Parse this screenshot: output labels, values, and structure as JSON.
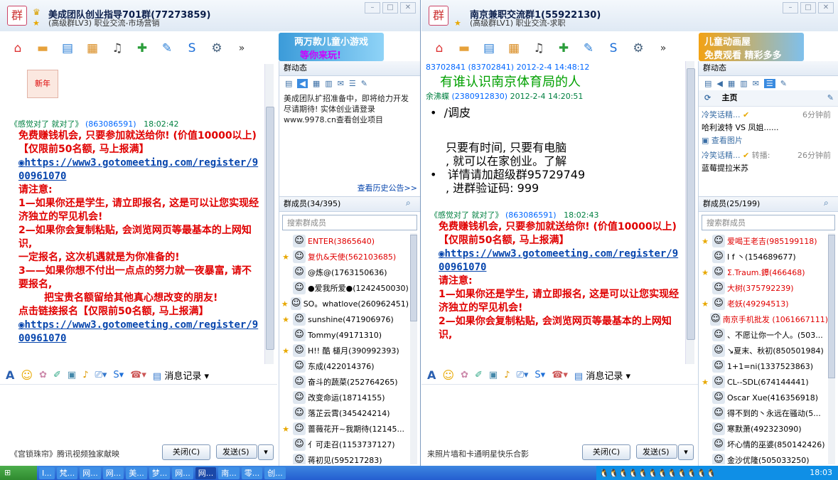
{
  "left_window": {
    "title": "美成团队创业指导701群(77273859)",
    "subtitle": "(高级群LV3) 职业交流-市场营销",
    "ad": {
      "line1": "两万款儿童小游戏",
      "line2": "等你来玩!"
    },
    "messages": [
      {
        "sender": "《感觉对了 就对了》",
        "id": "(863086591)",
        "time": "18:02:42"
      }
    ],
    "msg_lines": [
      "免费赚钱机会, 只要参加就送给你! (价值10000以上)",
      "【仅限前50名额, 马上报满】"
    ],
    "link1": "https://www3.gotomeeting.com/register/900961070",
    "msg_lines2": [
      "请注意:",
      "1—如果你还是学生, 请立即报名, 这是可以让您实现经济独立的罕见机会!",
      "2—如果你会复制粘贴, 会浏览网页等最基本的上网知识,",
      "一定报名, 这次机遇就是为你准备的!",
      "3——如果你想不付出一点点的努力就一夜暴富, 请不要报名,",
      "把宝贵名额留给其他真心想改变的朋友!",
      "点击链接报名【仅限前50名额, 马上报满】"
    ],
    "link2": "https://www3.gotomeeting.com/register/900961070",
    "history_label": "消息记录",
    "promo": "《宫锁珠帘》腾讯视频独家献映",
    "close_button": "关闭(C)",
    "send_button": "发送(S)",
    "notice_title": "群动态",
    "notice_text": "美成团队扩招准备中，即将给力开发尽请期待! 实体创业请登录www.9978.cn查看创业项目",
    "history_link": "查看历史公告>>",
    "members_title": "群成员(34/395)",
    "search_placeholder": "搜索群成员",
    "members": [
      {
        "name": "ENTER(3865640)",
        "color": "#e00000",
        "star": false
      },
      {
        "name": "复仇&天使(562103685)",
        "color": "#e00000",
        "star": true
      },
      {
        "name": "@炼@(1763150636)",
        "color": "#000",
        "star": false
      },
      {
        "name": "●爱我所爱●(1242450030)",
        "color": "#000",
        "star": false
      },
      {
        "name": "SO。whatlove(260962451)",
        "color": "#000",
        "star": true
      },
      {
        "name": "sunshine(471906976)",
        "color": "#000",
        "star": true
      },
      {
        "name": "Tommy(49171310)",
        "color": "#000",
        "star": false
      },
      {
        "name": "H!! 酷 檤月(390992393)",
        "color": "#000",
        "star": true
      },
      {
        "name": "东成(422014376)",
        "color": "#000",
        "star": false
      },
      {
        "name": "奋斗的蔬菜(252764265)",
        "color": "#000",
        "star": false
      },
      {
        "name": "改变命运(18714155)",
        "color": "#000",
        "star": false
      },
      {
        "name": "落芷云霄(345424214)",
        "color": "#000",
        "star": false
      },
      {
        "name": "蔷薇花开~我期待(12145...",
        "color": "#000",
        "star": true
      },
      {
        "name": "亻可走召(1153737127)",
        "color": "#000",
        "star": false
      },
      {
        "name": "蒋初见(595217283)",
        "color": "#000",
        "star": false
      }
    ]
  },
  "right_window": {
    "title": "南京兼职交流群1(55922130)",
    "subtitle": "(高级群LV1) 职业交流-求职",
    "ad": {
      "line1": "儿童动画屋",
      "line2": "免费观看 精彩多多"
    },
    "msg1_head": {
      "sender": "83702841",
      "id": "(83702841)",
      "time": "2012-2-4 14:48:12"
    },
    "msg1_text": "有谁认识南京体育局的人",
    "msg2_head": {
      "sender": "余沸蝶",
      "id": "(2380912830)",
      "time": "2012-2-4 14:20:51"
    },
    "msg2_text": "/调皮",
    "msg3_lines": [
      "只要有时间, 只要有电脑",
      ", 就可以在家创业。了解",
      "详情请加超级群95729749",
      ", 进群验证码: 999"
    ],
    "msg4_head": {
      "sender": "《感觉对了 就对了》",
      "id": "(863086591)",
      "time": "18:02:43"
    },
    "msg4_lines": [
      "免费赚钱机会, 只要参加就送给你! (价值10000以上)",
      "【仅限前50名额, 马上报满】"
    ],
    "link": "https://www3.gotomeeting.com/register/900961070",
    "msg4_lines2": [
      "请注意:",
      "1—如果你还是学生, 请立即报名, 这是可以让您实现经济独立的罕见机会!",
      "2—如果你会复制粘贴, 会浏览网页等最基本的上网知识,"
    ],
    "history_label": "消息记录",
    "promo": "来照片墙和卡通明星快乐合影",
    "close_button": "关闭(C)",
    "send_button": "发送(S)",
    "notice_title": "群动态",
    "main_tab": "主页",
    "feed": [
      {
        "user": "冷笑话精...",
        "time": "6分钟前",
        "text": "哈利波特 VS 凤姐......",
        "action": "查看图片"
      },
      {
        "user": "冷笑话精...",
        "extra": "转播:",
        "time": "26分钟前",
        "text": "蓝莓提拉米苏"
      }
    ],
    "members_title": "群成员(25/199)",
    "search_placeholder": "搜索群成员",
    "members": [
      {
        "name": "爱喝王老吉(985199118)",
        "color": "#e00000",
        "star": true
      },
      {
        "name": "I f 丶(154689677)",
        "color": "#000",
        "star": false
      },
      {
        "name": "Σ.Traum.鐔(466468)",
        "color": "#e00000",
        "star": true
      },
      {
        "name": "大树(375792239)",
        "color": "#e00000",
        "star": false
      },
      {
        "name": "老妖(49294513)",
        "color": "#e00000",
        "star": true
      },
      {
        "name": "南京手机批发 (1061667111)",
        "color": "#e00000",
        "star": false
      },
      {
        "name": "、不愿让你一个人。(503...",
        "color": "#000",
        "star": false
      },
      {
        "name": "↘夏末、秋初(850501984)",
        "color": "#000",
        "star": false
      },
      {
        "name": "1+1=ni(1337523863)",
        "color": "#000",
        "star": false
      },
      {
        "name": "CL--SDL(674144441)",
        "color": "#000",
        "star": true
      },
      {
        "name": "Oscar Xue(416356918)",
        "color": "#000",
        "star": false
      },
      {
        "name": "得不到的丶永远在骚动(5...",
        "color": "#000",
        "star": false
      },
      {
        "name": "寒默萧(492323090)",
        "color": "#000",
        "star": false
      },
      {
        "name": "坏心情的巫婆(850142426)",
        "color": "#000",
        "star": false
      },
      {
        "name": "金沙优隆(505033250)",
        "color": "#000",
        "star": false
      }
    ]
  },
  "taskbar": {
    "items": [
      {
        "label": "I...",
        "active": false
      },
      {
        "label": "梵...",
        "active": false
      },
      {
        "label": "网...",
        "active": false
      },
      {
        "label": "网...",
        "active": false
      },
      {
        "label": "美...",
        "active": false
      },
      {
        "label": "梦...",
        "active": false
      },
      {
        "label": "网...",
        "active": false
      },
      {
        "label": "网...",
        "active": true
      },
      {
        "label": "南...",
        "active": false
      },
      {
        "label": "零...",
        "active": false
      },
      {
        "label": "创...",
        "active": false
      }
    ],
    "clock": "18:03"
  }
}
